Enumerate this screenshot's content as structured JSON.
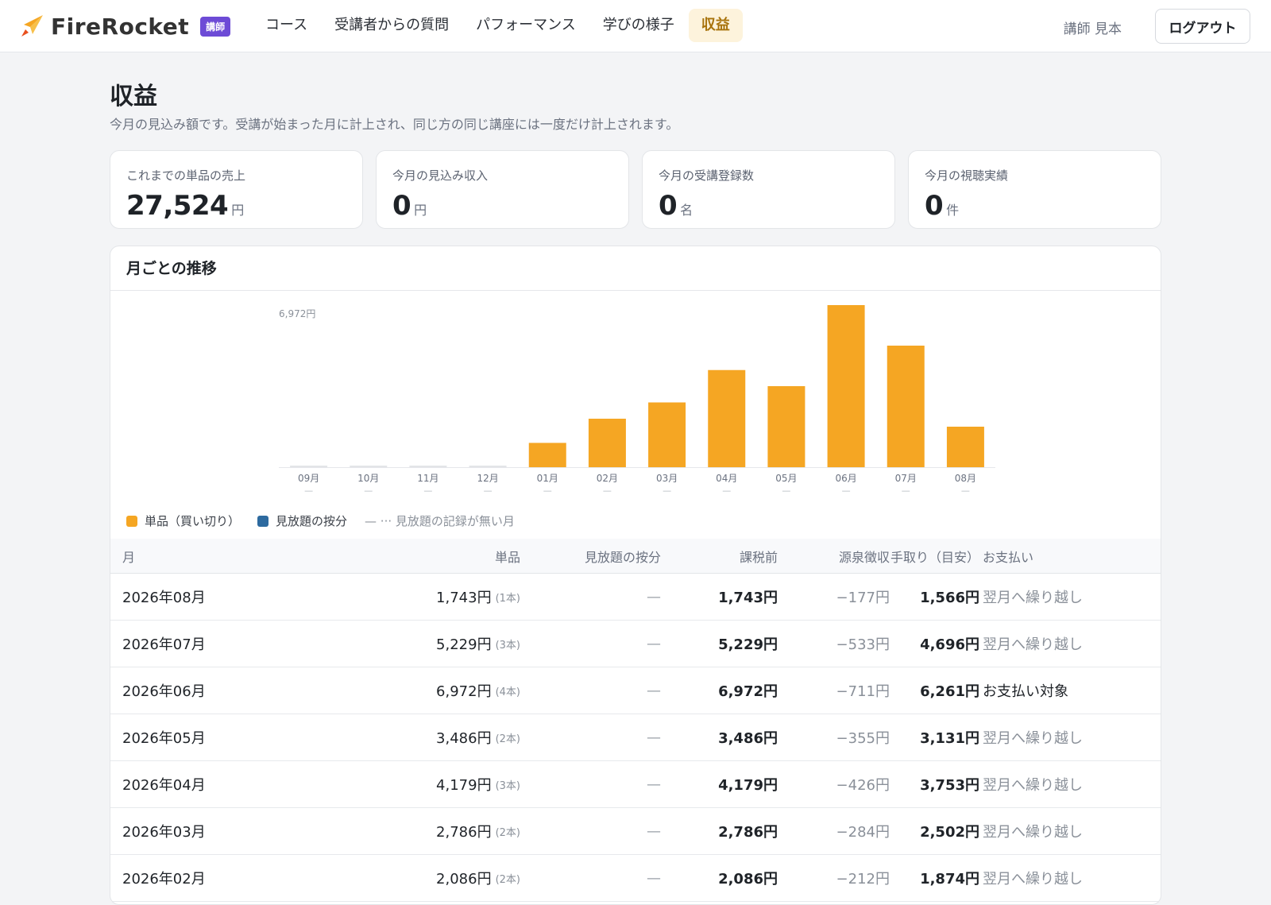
{
  "app": {
    "logo_text": "FireRocket",
    "role_badge": "講師",
    "brand_color": "#f5a623",
    "badge_color": "#6d4bd6"
  },
  "nav": {
    "items": [
      {
        "label": "コース",
        "active": false
      },
      {
        "label": "受講者からの質問",
        "active": false
      },
      {
        "label": "パフォーマンス",
        "active": false
      },
      {
        "label": "学びの様子",
        "active": false
      },
      {
        "label": "収益",
        "active": true
      }
    ],
    "user_name": "講師 見本",
    "logout_label": "ログアウト"
  },
  "page": {
    "title": "収益",
    "description": "今月の見込み額です。受講が始まった月に計上され、同じ方の同じ講座には一度だけ計上されます。"
  },
  "stats": [
    {
      "label": "これまでの単品の売上",
      "value": "27,524",
      "unit": "円"
    },
    {
      "label": "今月の見込み収入",
      "value": "0",
      "unit": "円"
    },
    {
      "label": "今月の受講登録数",
      "value": "0",
      "unit": "名"
    },
    {
      "label": "今月の視聴実績",
      "value": "0",
      "unit": "件"
    }
  ],
  "panel": {
    "title": "月ごとの推移"
  },
  "chart_data": {
    "type": "bar",
    "max_label": "6,972円",
    "categories": [
      "09月",
      "10月",
      "11月",
      "12月",
      "01月",
      "02月",
      "03月",
      "04月",
      "05月",
      "06月",
      "07月",
      "08月"
    ],
    "sub_labels": [
      "—",
      "—",
      "—",
      "—",
      "—",
      "—",
      "—",
      "—",
      "—",
      "—",
      "—",
      "—"
    ],
    "series": [
      {
        "name": "単品（買い切り）",
        "color": "#f5a623",
        "values": [
          0,
          0,
          0,
          0,
          1046,
          2086,
          2786,
          4179,
          3486,
          6972,
          5229,
          1743
        ]
      },
      {
        "name": "見放題の按分",
        "color": "#2d6a9f",
        "values": [
          0,
          0,
          0,
          0,
          0,
          0,
          0,
          0,
          0,
          0,
          0,
          0
        ]
      }
    ],
    "ylim": [
      0,
      6972
    ],
    "grid": false
  },
  "legend": {
    "single": "単品（買い切り）",
    "subscription": "見放題の按分",
    "missing": "— ··· 見放題の記録が無い月"
  },
  "table": {
    "headers": {
      "month": "月",
      "single": "単品",
      "subscription": "見放題の按分",
      "pretax": "課税前",
      "withholding": "源泉徴収",
      "net": "手取り（目安）",
      "payment": "お支払い"
    },
    "rows": [
      {
        "month": "2026年08月",
        "single": "1,743円",
        "count": "(1本)",
        "subscription": "—",
        "pretax": "1,743円",
        "withholding": "−177円",
        "net": "1,566円",
        "payment": "翌月へ繰り越し",
        "due": false
      },
      {
        "month": "2026年07月",
        "single": "5,229円",
        "count": "(3本)",
        "subscription": "—",
        "pretax": "5,229円",
        "withholding": "−533円",
        "net": "4,696円",
        "payment": "翌月へ繰り越し",
        "due": false
      },
      {
        "month": "2026年06月",
        "single": "6,972円",
        "count": "(4本)",
        "subscription": "—",
        "pretax": "6,972円",
        "withholding": "−711円",
        "net": "6,261円",
        "payment": "お支払い対象",
        "due": true
      },
      {
        "month": "2026年05月",
        "single": "3,486円",
        "count": "(2本)",
        "subscription": "—",
        "pretax": "3,486円",
        "withholding": "−355円",
        "net": "3,131円",
        "payment": "翌月へ繰り越し",
        "due": false
      },
      {
        "month": "2026年04月",
        "single": "4,179円",
        "count": "(3本)",
        "subscription": "—",
        "pretax": "4,179円",
        "withholding": "−426円",
        "net": "3,753円",
        "payment": "翌月へ繰り越し",
        "due": false
      },
      {
        "month": "2026年03月",
        "single": "2,786円",
        "count": "(2本)",
        "subscription": "—",
        "pretax": "2,786円",
        "withholding": "−284円",
        "net": "2,502円",
        "payment": "翌月へ繰り越し",
        "due": false
      },
      {
        "month": "2026年02月",
        "single": "2,086円",
        "count": "(2本)",
        "subscription": "—",
        "pretax": "2,086円",
        "withholding": "−212円",
        "net": "1,874円",
        "payment": "翌月へ繰り越し",
        "due": false
      }
    ]
  }
}
